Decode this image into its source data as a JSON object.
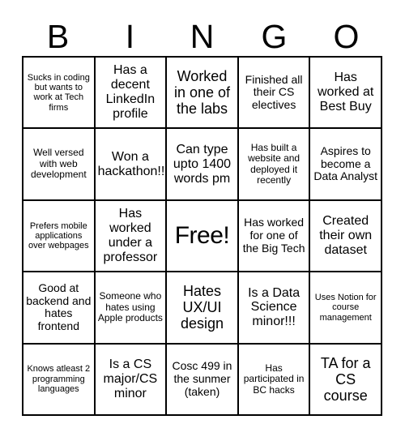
{
  "card": {
    "header_letters": [
      "B",
      "I",
      "N",
      "G",
      "O"
    ],
    "rows": [
      [
        {
          "text": "Sucks in coding but wants to work at Tech firms",
          "size": "fs-xs"
        },
        {
          "text": "Has a decent LinkedIn profile",
          "size": "fs-lg"
        },
        {
          "text": "Worked in one of the labs",
          "size": "fs-xl"
        },
        {
          "text": "Finished all their CS electives",
          "size": "fs-md"
        },
        {
          "text": "Has worked at Best Buy",
          "size": "fs-lg"
        }
      ],
      [
        {
          "text": "Well versed with web development",
          "size": "fs-sm"
        },
        {
          "text": "Won a hackathon!!",
          "size": "fs-lg"
        },
        {
          "text": "Can type upto 1400 words pm",
          "size": "fs-lg"
        },
        {
          "text": "Has built a website and deployed it recently",
          "size": "fs-sm"
        },
        {
          "text": "Aspires to become a Data Analyst",
          "size": "fs-md"
        }
      ],
      [
        {
          "text": "Prefers mobile applications over webpages",
          "size": "fs-xs"
        },
        {
          "text": "Has worked under a professor",
          "size": "fs-lg"
        },
        {
          "text": "Free!",
          "size": "fs-free"
        },
        {
          "text": "Has worked for one of the Big Tech",
          "size": "fs-md"
        },
        {
          "text": "Created their own dataset",
          "size": "fs-lg"
        }
      ],
      [
        {
          "text": "Good at backend and hates frontend",
          "size": "fs-md"
        },
        {
          "text": "Someone who hates using Apple products",
          "size": "fs-sm"
        },
        {
          "text": "Hates UX/UI design",
          "size": "fs-xl"
        },
        {
          "text": "Is a Data Science minor!!!",
          "size": "fs-lg"
        },
        {
          "text": "Uses Notion for course management",
          "size": "fs-xs"
        }
      ],
      [
        {
          "text": "Knows atleast 2 programming languages",
          "size": "fs-xs"
        },
        {
          "text": "Is a CS major/CS minor",
          "size": "fs-lg"
        },
        {
          "text": "Cosc 499 in the sunmer (taken)",
          "size": "fs-md"
        },
        {
          "text": "Has participated in BC hacks",
          "size": "fs-sm"
        },
        {
          "text": "TA for a CS course",
          "size": "fs-xl"
        }
      ]
    ]
  }
}
